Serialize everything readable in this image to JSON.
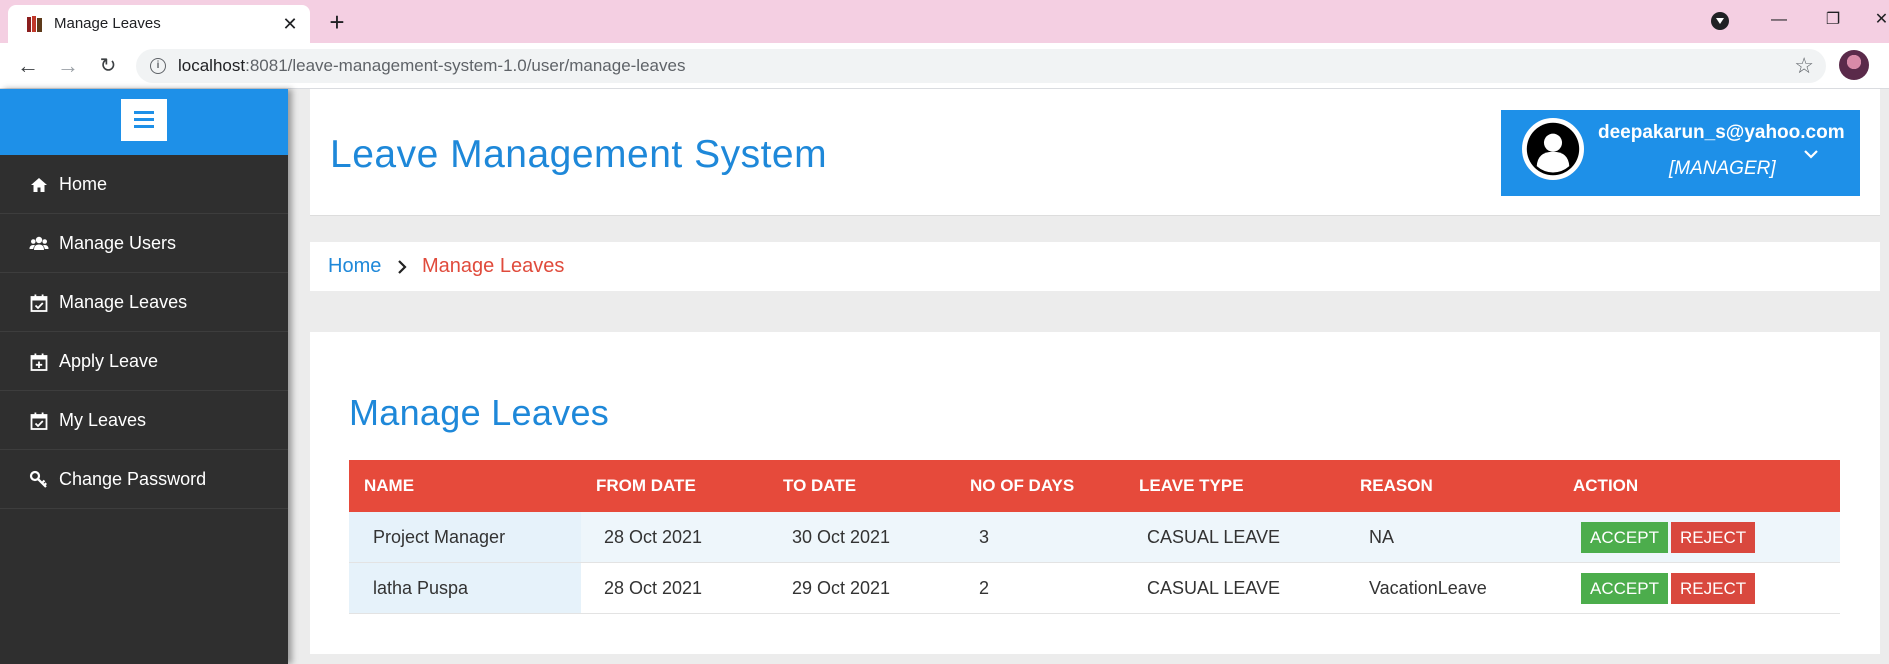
{
  "browser": {
    "tab_title": "Manage Leaves",
    "url_host": "localhost",
    "url_path": ":8081/leave-management-system-1.0/user/manage-leaves"
  },
  "sidebar": {
    "items": [
      {
        "label": "Home",
        "icon": "home-icon"
      },
      {
        "label": "Manage Users",
        "icon": "users-icon"
      },
      {
        "label": "Manage Leaves",
        "icon": "calendar-check-icon"
      },
      {
        "label": "Apply Leave",
        "icon": "calendar-plus-icon"
      },
      {
        "label": "My Leaves",
        "icon": "calendar-check-icon"
      },
      {
        "label": "Change Password",
        "icon": "key-icon"
      }
    ]
  },
  "header": {
    "title": "Leave Management System",
    "user_email": "deepakarun_s@yahoo.com",
    "user_role": "[MANAGER]"
  },
  "breadcrumb": {
    "home": "Home",
    "current": "Manage Leaves"
  },
  "main": {
    "title": "Manage Leaves",
    "columns": [
      "NAME",
      "FROM DATE",
      "TO DATE",
      "NO OF DAYS",
      "LEAVE TYPE",
      "REASON",
      "ACTION"
    ],
    "rows": [
      {
        "name": "Project Manager",
        "from": "28 Oct 2021",
        "to": "30 Oct 2021",
        "days": "3",
        "type": "CASUAL LEAVE",
        "reason": "NA",
        "accept": "ACCEPT",
        "reject": "REJECT"
      },
      {
        "name": "latha Puspa",
        "from": "28 Oct 2021",
        "to": "29 Oct 2021",
        "days": "2",
        "type": "CASUAL LEAVE",
        "reason": "VacationLeave",
        "accept": "ACCEPT",
        "reject": "REJECT"
      }
    ]
  },
  "colors": {
    "primary": "#1e90e8",
    "sidebar_bg": "#2f2f2f",
    "table_header": "#e64a3b",
    "accept": "#4cad4c",
    "reject": "#d9483e"
  }
}
